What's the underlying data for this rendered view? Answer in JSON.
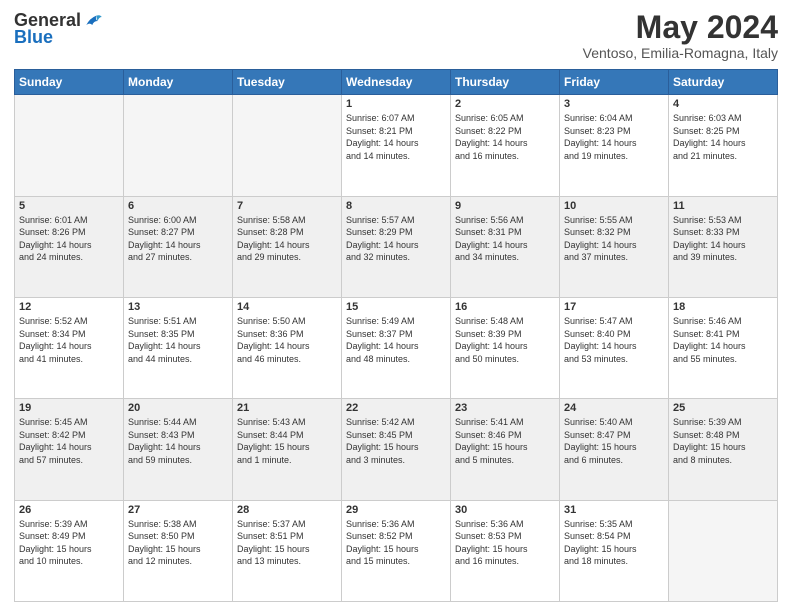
{
  "header": {
    "logo_general": "General",
    "logo_blue": "Blue",
    "month_title": "May 2024",
    "location": "Ventoso, Emilia-Romagna, Italy"
  },
  "days_of_week": [
    "Sunday",
    "Monday",
    "Tuesday",
    "Wednesday",
    "Thursday",
    "Friday",
    "Saturday"
  ],
  "weeks": [
    [
      {
        "day": "",
        "info": ""
      },
      {
        "day": "",
        "info": ""
      },
      {
        "day": "",
        "info": ""
      },
      {
        "day": "1",
        "info": "Sunrise: 6:07 AM\nSunset: 8:21 PM\nDaylight: 14 hours\nand 14 minutes."
      },
      {
        "day": "2",
        "info": "Sunrise: 6:05 AM\nSunset: 8:22 PM\nDaylight: 14 hours\nand 16 minutes."
      },
      {
        "day": "3",
        "info": "Sunrise: 6:04 AM\nSunset: 8:23 PM\nDaylight: 14 hours\nand 19 minutes."
      },
      {
        "day": "4",
        "info": "Sunrise: 6:03 AM\nSunset: 8:25 PM\nDaylight: 14 hours\nand 21 minutes."
      }
    ],
    [
      {
        "day": "5",
        "info": "Sunrise: 6:01 AM\nSunset: 8:26 PM\nDaylight: 14 hours\nand 24 minutes."
      },
      {
        "day": "6",
        "info": "Sunrise: 6:00 AM\nSunset: 8:27 PM\nDaylight: 14 hours\nand 27 minutes."
      },
      {
        "day": "7",
        "info": "Sunrise: 5:58 AM\nSunset: 8:28 PM\nDaylight: 14 hours\nand 29 minutes."
      },
      {
        "day": "8",
        "info": "Sunrise: 5:57 AM\nSunset: 8:29 PM\nDaylight: 14 hours\nand 32 minutes."
      },
      {
        "day": "9",
        "info": "Sunrise: 5:56 AM\nSunset: 8:31 PM\nDaylight: 14 hours\nand 34 minutes."
      },
      {
        "day": "10",
        "info": "Sunrise: 5:55 AM\nSunset: 8:32 PM\nDaylight: 14 hours\nand 37 minutes."
      },
      {
        "day": "11",
        "info": "Sunrise: 5:53 AM\nSunset: 8:33 PM\nDaylight: 14 hours\nand 39 minutes."
      }
    ],
    [
      {
        "day": "12",
        "info": "Sunrise: 5:52 AM\nSunset: 8:34 PM\nDaylight: 14 hours\nand 41 minutes."
      },
      {
        "day": "13",
        "info": "Sunrise: 5:51 AM\nSunset: 8:35 PM\nDaylight: 14 hours\nand 44 minutes."
      },
      {
        "day": "14",
        "info": "Sunrise: 5:50 AM\nSunset: 8:36 PM\nDaylight: 14 hours\nand 46 minutes."
      },
      {
        "day": "15",
        "info": "Sunrise: 5:49 AM\nSunset: 8:37 PM\nDaylight: 14 hours\nand 48 minutes."
      },
      {
        "day": "16",
        "info": "Sunrise: 5:48 AM\nSunset: 8:39 PM\nDaylight: 14 hours\nand 50 minutes."
      },
      {
        "day": "17",
        "info": "Sunrise: 5:47 AM\nSunset: 8:40 PM\nDaylight: 14 hours\nand 53 minutes."
      },
      {
        "day": "18",
        "info": "Sunrise: 5:46 AM\nSunset: 8:41 PM\nDaylight: 14 hours\nand 55 minutes."
      }
    ],
    [
      {
        "day": "19",
        "info": "Sunrise: 5:45 AM\nSunset: 8:42 PM\nDaylight: 14 hours\nand 57 minutes."
      },
      {
        "day": "20",
        "info": "Sunrise: 5:44 AM\nSunset: 8:43 PM\nDaylight: 14 hours\nand 59 minutes."
      },
      {
        "day": "21",
        "info": "Sunrise: 5:43 AM\nSunset: 8:44 PM\nDaylight: 15 hours\nand 1 minute."
      },
      {
        "day": "22",
        "info": "Sunrise: 5:42 AM\nSunset: 8:45 PM\nDaylight: 15 hours\nand 3 minutes."
      },
      {
        "day": "23",
        "info": "Sunrise: 5:41 AM\nSunset: 8:46 PM\nDaylight: 15 hours\nand 5 minutes."
      },
      {
        "day": "24",
        "info": "Sunrise: 5:40 AM\nSunset: 8:47 PM\nDaylight: 15 hours\nand 6 minutes."
      },
      {
        "day": "25",
        "info": "Sunrise: 5:39 AM\nSunset: 8:48 PM\nDaylight: 15 hours\nand 8 minutes."
      }
    ],
    [
      {
        "day": "26",
        "info": "Sunrise: 5:39 AM\nSunset: 8:49 PM\nDaylight: 15 hours\nand 10 minutes."
      },
      {
        "day": "27",
        "info": "Sunrise: 5:38 AM\nSunset: 8:50 PM\nDaylight: 15 hours\nand 12 minutes."
      },
      {
        "day": "28",
        "info": "Sunrise: 5:37 AM\nSunset: 8:51 PM\nDaylight: 15 hours\nand 13 minutes."
      },
      {
        "day": "29",
        "info": "Sunrise: 5:36 AM\nSunset: 8:52 PM\nDaylight: 15 hours\nand 15 minutes."
      },
      {
        "day": "30",
        "info": "Sunrise: 5:36 AM\nSunset: 8:53 PM\nDaylight: 15 hours\nand 16 minutes."
      },
      {
        "day": "31",
        "info": "Sunrise: 5:35 AM\nSunset: 8:54 PM\nDaylight: 15 hours\nand 18 minutes."
      },
      {
        "day": "",
        "info": ""
      }
    ]
  ]
}
